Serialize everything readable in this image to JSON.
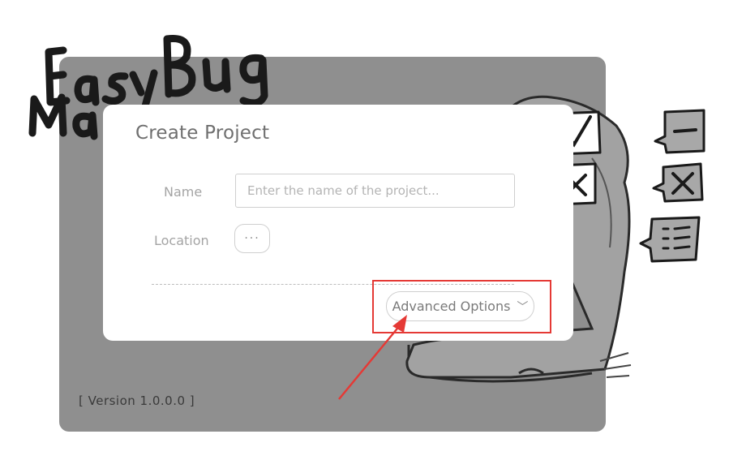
{
  "logo": {
    "text": "EasyBug Maker",
    "text_line1": "EasyBug",
    "text_line2": "Maker"
  },
  "dialog": {
    "title": "Create Project",
    "name_label": "Name",
    "name_placeholder": "Enter the name of the project...",
    "name_value": "",
    "location_label": "Location",
    "browse_label": "···",
    "advanced_label": "Advanced Options",
    "advanced_icon": "chevron-down-icon"
  },
  "footer": {
    "version": "[ Version 1.0.0.0 ]"
  },
  "colors": {
    "window_bg": "#8f8f8f",
    "dialog_bg": "#ffffff",
    "highlight": "#e53935",
    "text_primary": "#6f6f6f",
    "text_muted": "#a4a4a4"
  }
}
